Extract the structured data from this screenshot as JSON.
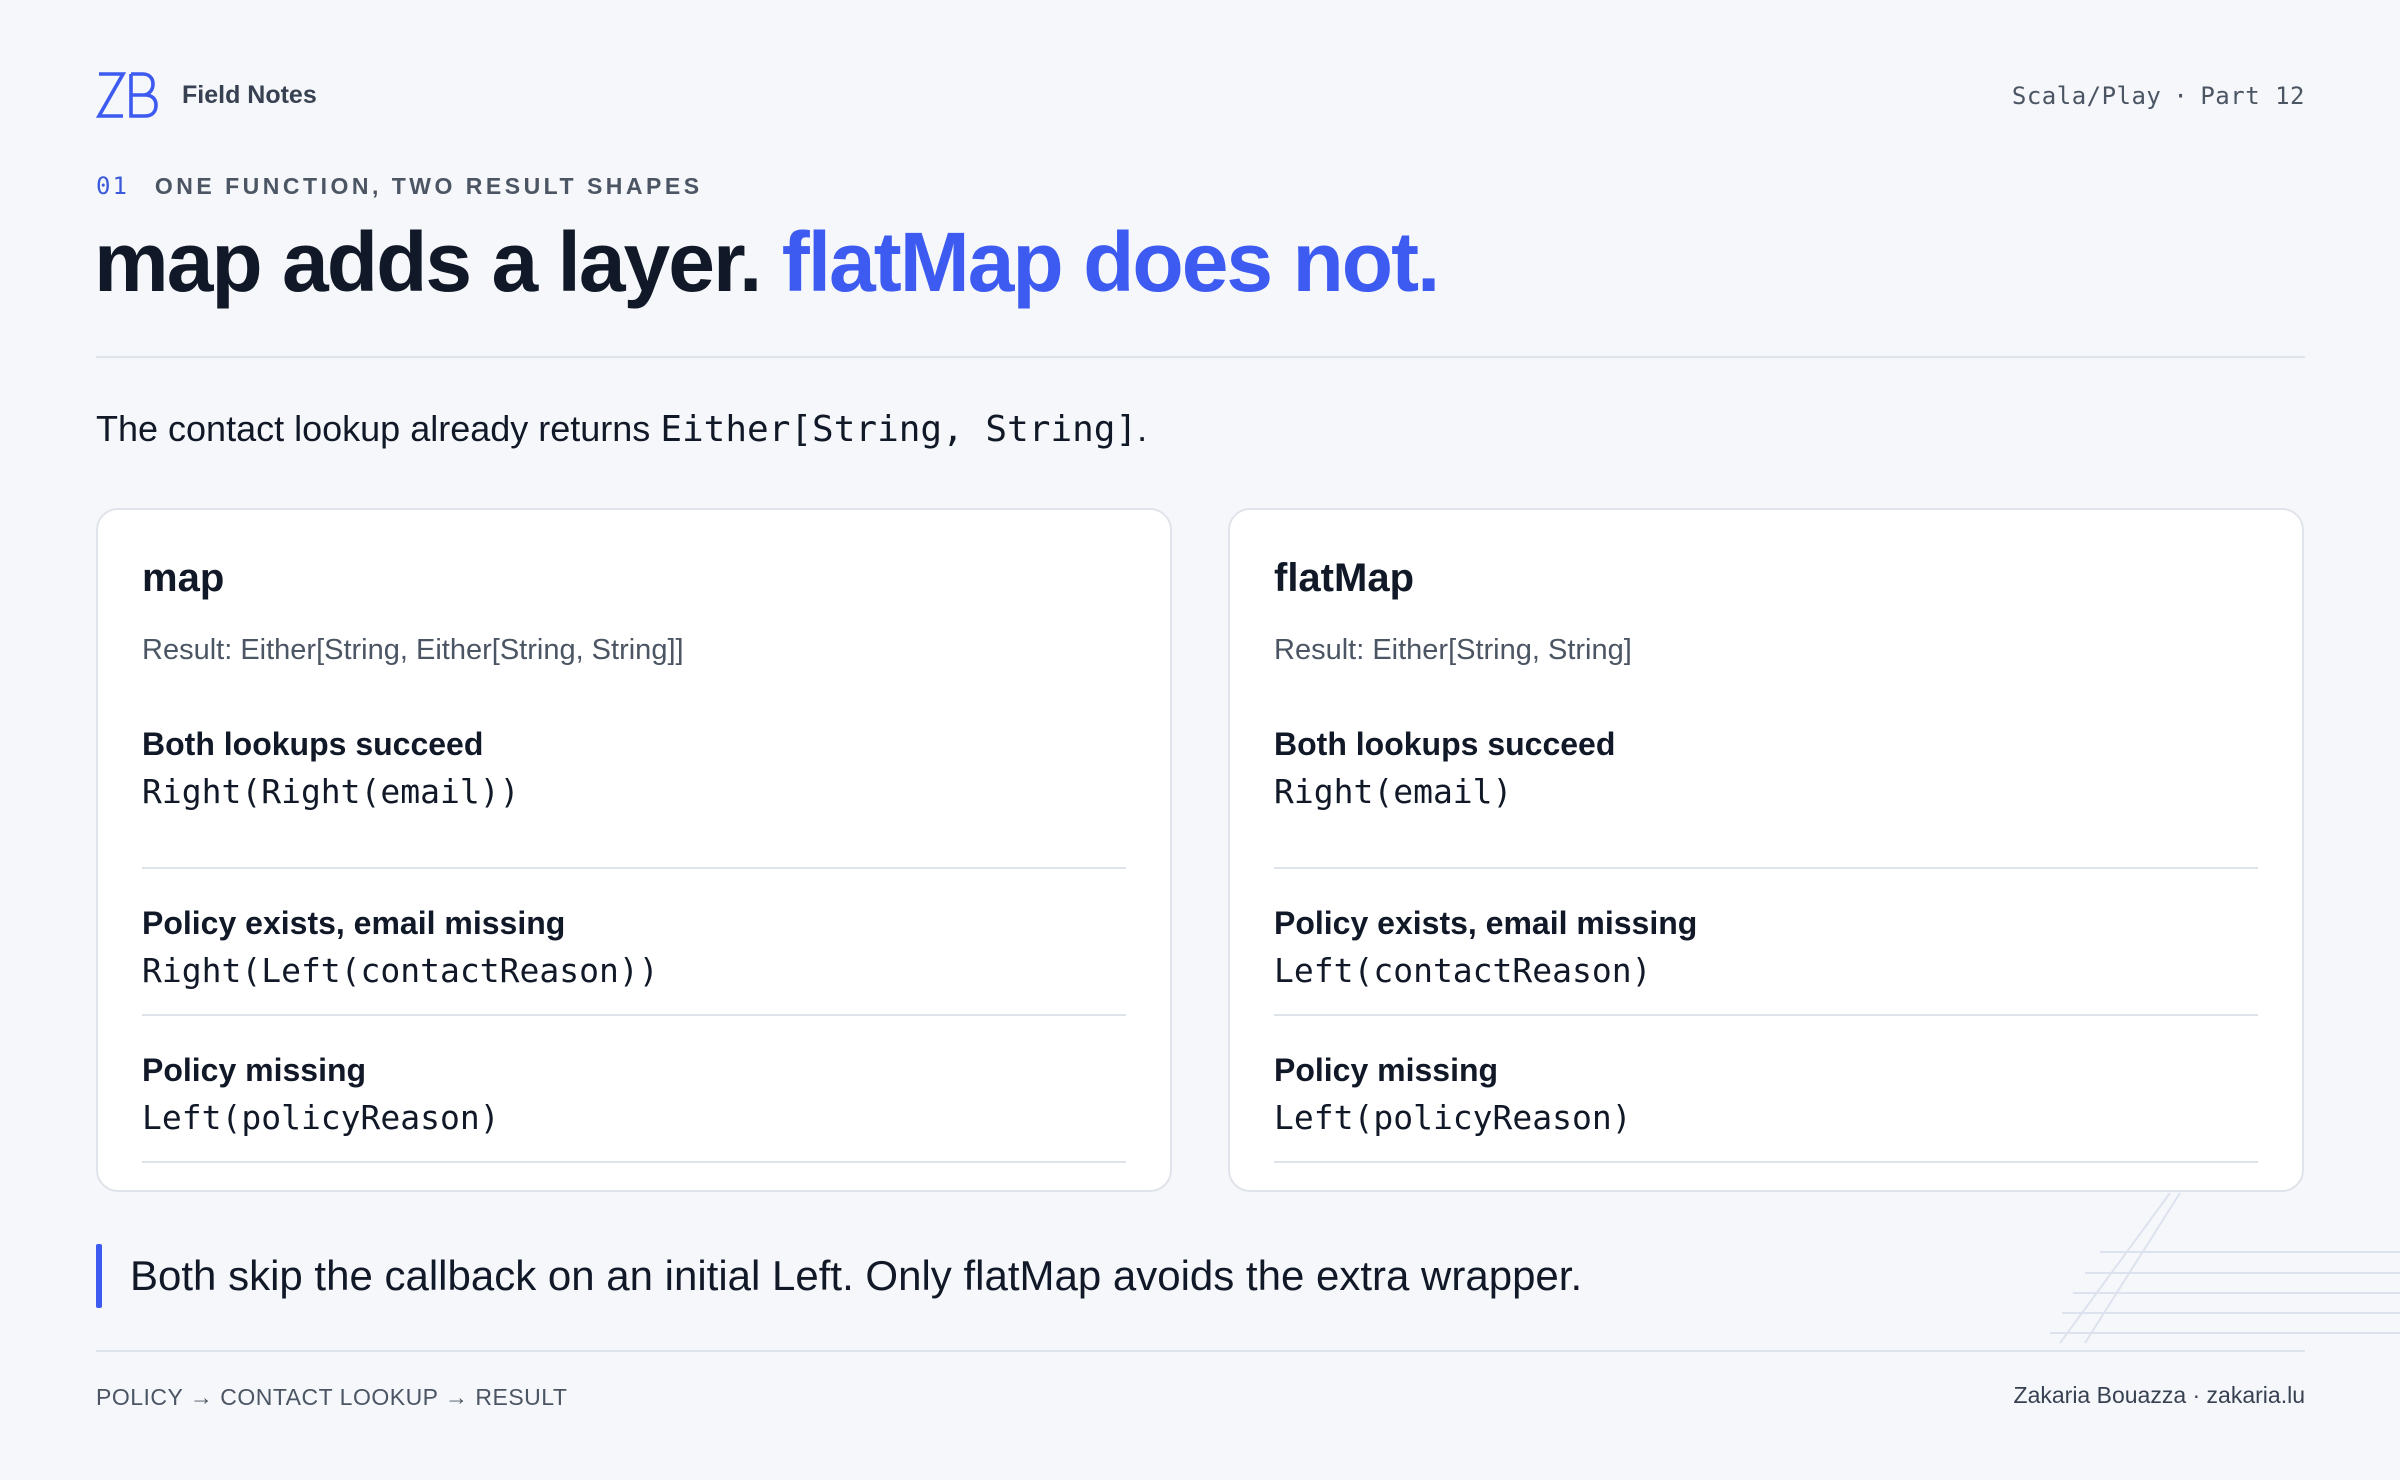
{
  "header": {
    "logo_text": "ZB",
    "brand": "Field Notes",
    "series": "Scala/Play",
    "separator": "·",
    "part": "Part 12"
  },
  "eyebrow": {
    "number": "01",
    "text": "ONE FUNCTION, TWO RESULT SHAPES"
  },
  "headline": {
    "part1": "map adds a layer.",
    "part2": "flatMap does not."
  },
  "lede": {
    "text": "The contact lookup already returns",
    "code": "Either[String, String]",
    "end": "."
  },
  "cards": [
    {
      "title": "map",
      "result": "Result: Either[String, Either[String, String]]",
      "rows": [
        {
          "label": "Both lookups succeed",
          "value": "Right(Right(email))"
        },
        {
          "label": "Policy exists, email missing",
          "value": "Right(Left(contactReason))"
        },
        {
          "label": "Policy missing",
          "value": "Left(policyReason)"
        }
      ]
    },
    {
      "title": "flatMap",
      "result": "Result: Either[String, String]",
      "rows": [
        {
          "label": "Both lookups succeed",
          "value": "Right(email)"
        },
        {
          "label": "Policy exists, email missing",
          "value": "Left(contactReason)"
        },
        {
          "label": "Policy missing",
          "value": "Left(policyReason)"
        }
      ]
    }
  ],
  "callout": "Both skip the callback on an initial Left. Only flatMap avoids the extra wrapper.",
  "footer": {
    "flow": "POLICY → CONTACT LOOKUP → RESULT",
    "author": "Zakaria Bouazza · zakaria.lu"
  },
  "colors": {
    "accent": "#3d5af1",
    "background": "#f5f7fa",
    "text": "#111827",
    "muted": "#4b5563"
  }
}
